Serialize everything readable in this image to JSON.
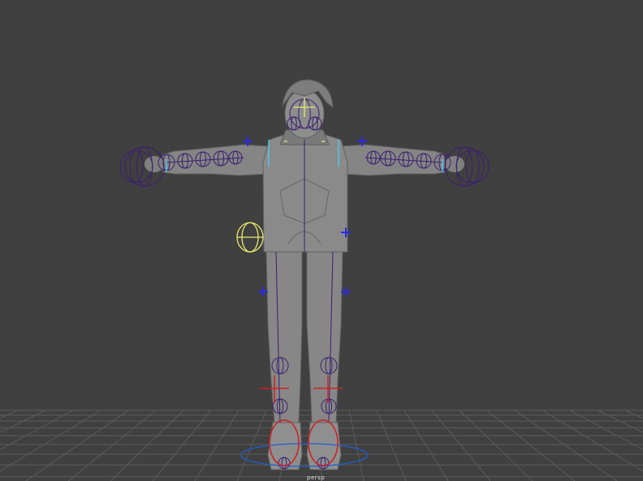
{
  "viewport": {
    "background": "#404040",
    "camera_label": "persp"
  },
  "colors": {
    "grid": "#5a5a5a",
    "mesh": "#8a8a8a",
    "mesh_shade": "#6a6a6a",
    "joint": "#3a1f6e",
    "selected": "#e9e970",
    "ik_handle": "#2020e0",
    "ik_foot": "#d02020",
    "cyan": "#4fc6e6",
    "ground_ring": "#1f5fd0"
  },
  "icons": {
    "root_control": "yellow-circle-control-icon",
    "head_control": "yellow-cross-control-icon",
    "ik_handles": "blue-cross-icon"
  }
}
